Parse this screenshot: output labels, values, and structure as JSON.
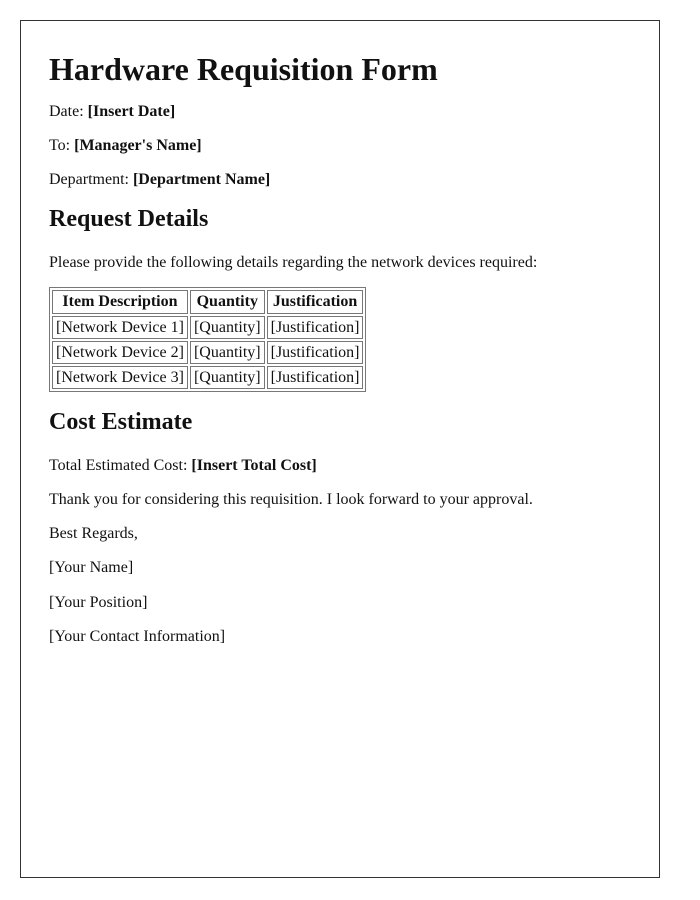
{
  "title": "Hardware Requisition Form",
  "meta": {
    "date_label": "Date: ",
    "date_value": "[Insert Date]",
    "to_label": "To: ",
    "to_value": "[Manager's Name]",
    "department_label": "Department: ",
    "department_value": "[Department Name]"
  },
  "request_details": {
    "heading": "Request Details",
    "intro": "Please provide the following details regarding the network devices required:",
    "table": {
      "headers": [
        "Item Description",
        "Quantity",
        "Justification"
      ],
      "rows": [
        [
          "[Network Device 1]",
          "[Quantity]",
          "[Justification]"
        ],
        [
          "[Network Device 2]",
          "[Quantity]",
          "[Justification]"
        ],
        [
          "[Network Device 3]",
          "[Quantity]",
          "[Justification]"
        ]
      ]
    }
  },
  "cost_estimate": {
    "heading": "Cost Estimate",
    "total_label": "Total Estimated Cost: ",
    "total_value": "[Insert Total Cost]"
  },
  "closing": {
    "thanks": "Thank you for considering this requisition. I look forward to your approval.",
    "regards": "Best Regards,",
    "name": "[Your Name]",
    "position": "[Your Position]",
    "contact": "[Your Contact Information]"
  }
}
